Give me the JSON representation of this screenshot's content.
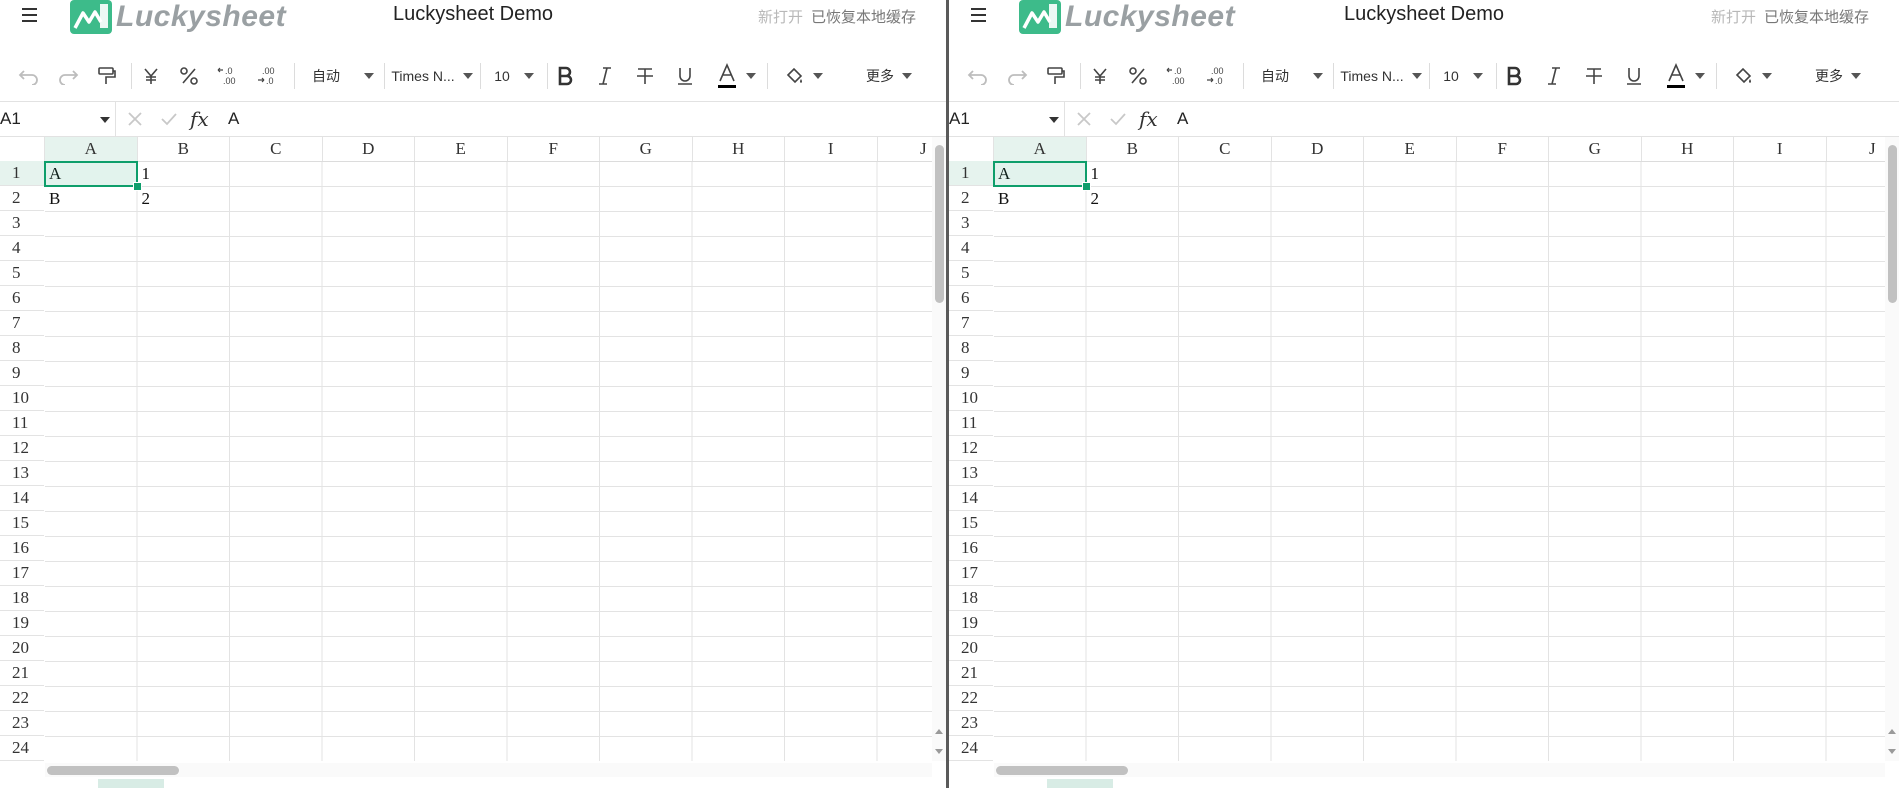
{
  "app_title": "Luckysheet Demo",
  "logo_text": "Luckysheet",
  "status": {
    "new_open": "新打开",
    "restored": "已恢复本地缓存"
  },
  "toolbar": {
    "format_auto": "自动",
    "font_name": "Times N...",
    "font_size": "10",
    "more": "更多"
  },
  "formula_bar": {
    "cell_ref": "A1",
    "fx": "fx",
    "formula_value": "A"
  },
  "columns": [
    "A",
    "B",
    "C",
    "D",
    "E",
    "F",
    "G",
    "H",
    "I",
    "J"
  ],
  "rows": [
    "1",
    "2",
    "3",
    "4",
    "5",
    "6",
    "7",
    "8",
    "9",
    "10",
    "11",
    "12",
    "13",
    "14",
    "15",
    "16",
    "17",
    "18",
    "19",
    "20",
    "21",
    "22",
    "23",
    "24"
  ],
  "cells": {
    "A1": "A",
    "B1": "1",
    "A2": "B",
    "B2": "2"
  },
  "selected_cell": "A1",
  "colors": {
    "accent": "#0e9e6b",
    "selection_fill": "#e6f3ee",
    "logo_green": "#3dbb8a"
  }
}
